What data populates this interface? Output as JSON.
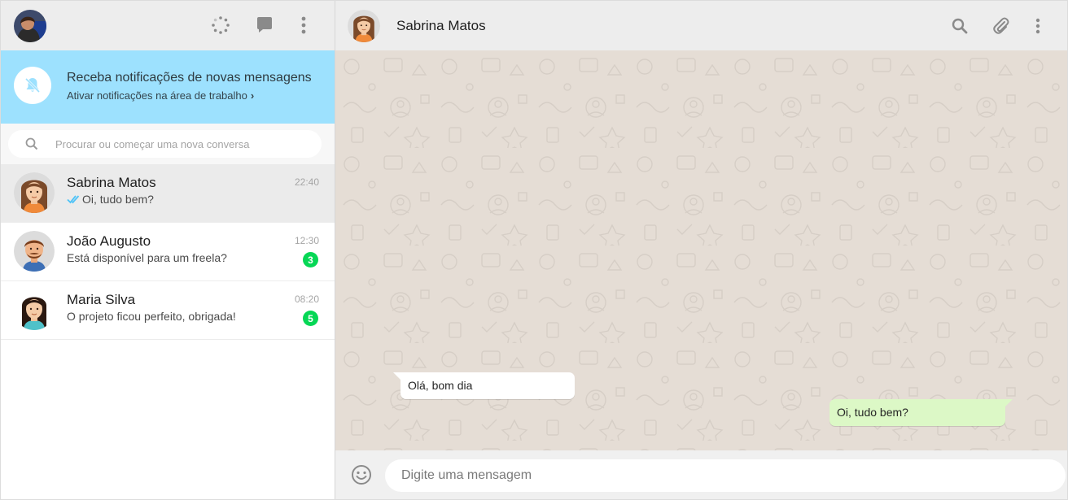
{
  "sidebar": {
    "header": {
      "icons": [
        "status-icon",
        "new-chat-icon",
        "menu-icon"
      ]
    },
    "notification": {
      "title": "Receba notificações de novas mensagens",
      "subtitle": "Ativar notificações na área de trabalho",
      "chevron": "›"
    },
    "search": {
      "placeholder": "Procurar ou começar uma nova conversa"
    },
    "chats": [
      {
        "name": "Sabrina Matos",
        "time": "22:40",
        "last_message": "Oi, tudo bem?",
        "unread": "",
        "read_ticks": true,
        "active": true
      },
      {
        "name": "João Augusto",
        "time": "12:30",
        "last_message": "Está disponível para um freela?",
        "unread": "3"
      },
      {
        "name": "Maria Silva",
        "time": "08:20",
        "last_message": "O projeto ficou perfeito, obrigada!",
        "unread": "5"
      }
    ]
  },
  "chat": {
    "contact_name": "Sabrina Matos",
    "messages": [
      {
        "direction": "in",
        "text": "Olá, bom dia"
      },
      {
        "direction": "out",
        "text": "Oi, tudo bem?"
      }
    ],
    "composer": {
      "placeholder": "Digite uma mensagem"
    }
  },
  "colors": {
    "notification_bg": "#9de1fe",
    "unread_badge": "#06d755",
    "outgoing_bubble": "#dcf8c6",
    "chat_background": "#e5ddd5",
    "read_tick": "#4fc3f7"
  }
}
